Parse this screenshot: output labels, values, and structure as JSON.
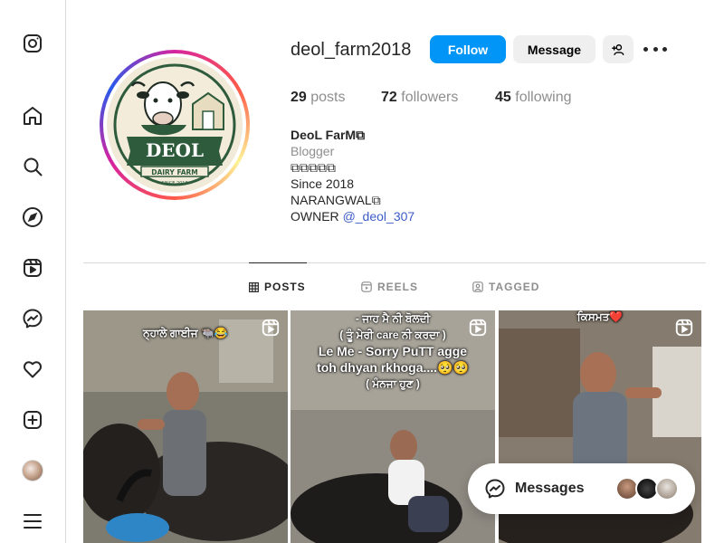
{
  "sidebar": {
    "items": [
      {
        "name": "instagram-logo-icon"
      },
      {
        "name": "home-icon"
      },
      {
        "name": "search-icon"
      },
      {
        "name": "explore-icon"
      },
      {
        "name": "reels-icon"
      },
      {
        "name": "messenger-icon"
      },
      {
        "name": "notifications-heart-icon"
      },
      {
        "name": "create-plus-icon"
      },
      {
        "name": "profile-avatar"
      },
      {
        "name": "more-menu-icon"
      }
    ]
  },
  "profile": {
    "username": "deol_farm2018",
    "follow_label": "Follow",
    "message_label": "Message",
    "stats": {
      "posts_count": "29",
      "posts_label": "posts",
      "followers_count": "72",
      "followers_label": "followers",
      "following_count": "45",
      "following_label": "following"
    },
    "bio": {
      "name": "DeoL FarM⧉",
      "category": "Blogger",
      "line_glyphs": "⧉⧉⧉⧉⧉",
      "line_since": "Since 2018",
      "line_location": "NARANGWAL⧉",
      "owner_prefix": "OWNER ",
      "owner_mention": "@_deol_307"
    },
    "logo": {
      "brand": "DEOL",
      "subtitle": "DAIRY FARM",
      "since": "SINCE 2018"
    }
  },
  "tabs": [
    {
      "label": "POSTS",
      "active": true
    },
    {
      "label": "REELS",
      "active": false
    },
    {
      "label": "TAGGED",
      "active": false
    }
  ],
  "posts": [
    {
      "caption_lines": [
        "ਨ੍ਹਾਲੇ ਗਾਈਜ 🐃😂"
      ]
    },
    {
      "caption_lines": [
        "- ਜਾਹ ਮੈ ਨੀ ਬੋਲਦੀ",
        "( ਤੂੰ ਮੇਰੀ care ਨੀ ਕਰਦਾ )",
        "Le Me - Sorry PuTT agge",
        "toh dhyan rkhoga....🥺🥺",
        "( ਮੰਨਜਾ ਹੁਣ )"
      ]
    },
    {
      "caption_lines": [
        "ਕਿਸਮਤ❤️"
      ]
    }
  ],
  "messages": {
    "label": "Messages"
  },
  "colors": {
    "accent": "#0095f6",
    "muted": "#8e8e8e",
    "link": "#3d5cc6"
  }
}
